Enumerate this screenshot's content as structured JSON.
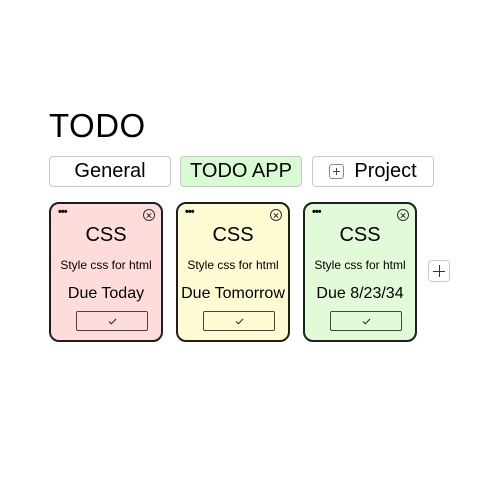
{
  "page": {
    "title": "TODO"
  },
  "tabs": [
    {
      "label": "General",
      "active": false
    },
    {
      "label": "TODO APP",
      "active": true,
      "color": "#d9fbd3"
    },
    {
      "label": "Project",
      "icon": "plus-icon",
      "active": false
    }
  ],
  "cards": [
    {
      "title": "CSS",
      "description": "Style css for html",
      "due": "Due Today",
      "color": "#ffdcdc",
      "menu_icon": "ellipsis-icon",
      "close_icon": "close-circle-icon",
      "check_icon": "check-icon"
    },
    {
      "title": "CSS",
      "description": "Style css for html",
      "due": "Due Tomorrow",
      "color": "#fffbd3",
      "menu_icon": "ellipsis-icon",
      "close_icon": "close-circle-icon",
      "check_icon": "check-icon"
    },
    {
      "title": "CSS",
      "description": "Style css for html",
      "due": "Due 8/23/34",
      "color": "#e1fbd8",
      "menu_icon": "ellipsis-icon",
      "close_icon": "close-circle-icon",
      "check_icon": "check-icon"
    }
  ],
  "menu_glyph": "•••",
  "add_card": {
    "icon": "plus-icon"
  }
}
